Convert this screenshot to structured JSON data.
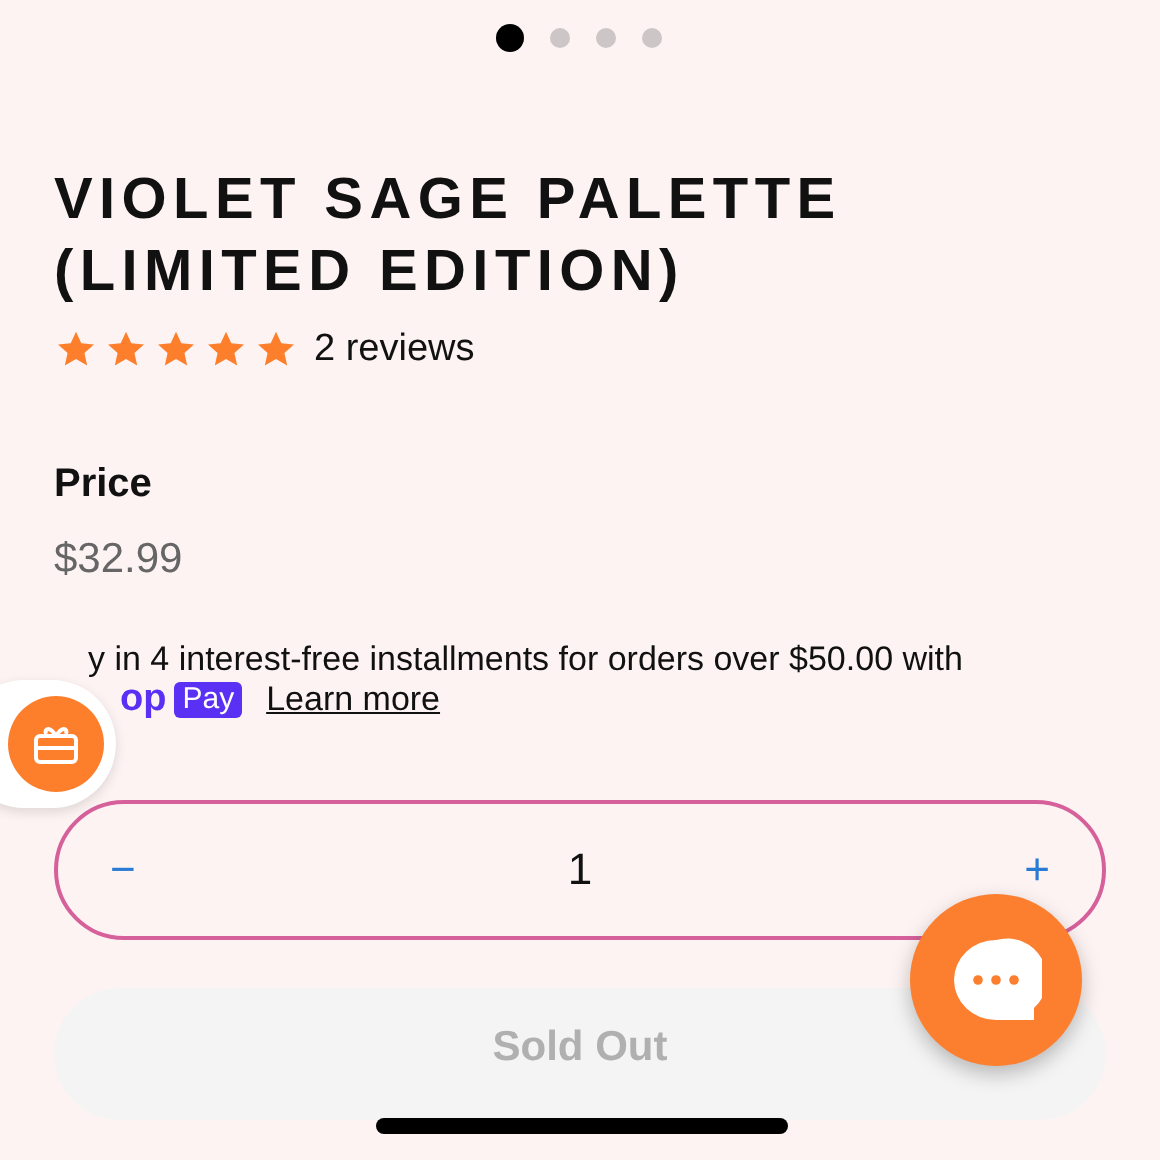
{
  "carousel_dots": [
    {
      "selected": true
    },
    {
      "selected": false
    },
    {
      "selected": false
    },
    {
      "selected": false
    }
  ],
  "product": {
    "title_lines": [
      "VIOLET SAGE PALETTE",
      "(LIMITED EDITION)"
    ],
    "stars": 5,
    "reviews": "2 reviews"
  },
  "price": {
    "label": "Price",
    "value": "$32.99"
  },
  "installments": {
    "text": "y in 4 interest-free installments for orders over $50.00 with",
    "brand_part": "op",
    "brand_badge": "Pay",
    "link": "Learn more"
  },
  "quantity": {
    "minus": "−",
    "value": "1",
    "plus": "+"
  },
  "buy_button": {
    "label": "Sold Out",
    "disabled": true
  }
}
